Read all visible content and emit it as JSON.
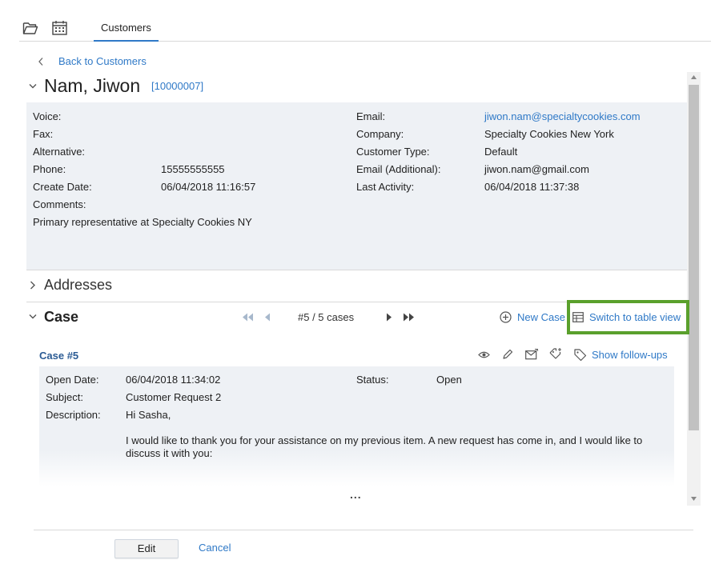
{
  "tabs": {
    "customers": "Customers"
  },
  "nav": {
    "back": "Back to Customers"
  },
  "customer": {
    "name": "Nam, Jiwon",
    "id": "[10000007]",
    "fields": {
      "voice_label": "Voice:",
      "fax_label": "Fax:",
      "alternative_label": "Alternative:",
      "phone_label": "Phone:",
      "phone_value": "15555555555",
      "create_date_label": "Create Date:",
      "create_date_value": "06/04/2018 11:16:57",
      "comments_label": "Comments:",
      "comments_value": "Primary representative at Specialty Cookies NY",
      "email_label": "Email:",
      "email_value": "jiwon.nam@specialtycookies.com",
      "company_label": "Company:",
      "company_value": "Specialty Cookies New York",
      "customer_type_label": "Customer Type:",
      "customer_type_value": "Default",
      "email_additional_label": "Email (Additional):",
      "email_additional_value": "jiwon.nam@gmail.com",
      "last_activity_label": "Last Activity:",
      "last_activity_value": "06/04/2018 11:37:38"
    }
  },
  "sections": {
    "addresses": "Addresses",
    "case": "Case"
  },
  "case_nav": {
    "counter": "#5 / 5 cases",
    "new_case": "New Case",
    "switch_view": "Switch to table view"
  },
  "case_item": {
    "title": "Case #5",
    "show_followups": "Show follow-ups",
    "open_date_label": "Open Date:",
    "open_date_value": "06/04/2018 11:34:02",
    "status_label": "Status:",
    "status_value": "Open",
    "subject_label": "Subject:",
    "subject_value": "Customer Request 2",
    "description_label": "Description:",
    "description_line1": "Hi Sasha,",
    "description_line2": "I would like to thank you for your assistance on my previous item. A new request has come in, and I would like to",
    "description_line3": "discuss it with you:",
    "more": "..."
  },
  "footer": {
    "edit": "Edit",
    "cancel": "Cancel"
  },
  "colors": {
    "accent": "#2f79c7",
    "highlight": "#5aa02c",
    "panel": "#eef1f5"
  },
  "icons": [
    "folder-icon",
    "calendar-icon",
    "chevron-left-icon",
    "chevron-down-icon",
    "chevron-right-icon",
    "first-page-icon",
    "prev-page-icon",
    "next-page-icon",
    "last-page-icon",
    "plus-circle-icon",
    "table-icon",
    "eye-icon",
    "pencil-icon",
    "mail-icon",
    "tag-add-icon",
    "tag-icon"
  ]
}
